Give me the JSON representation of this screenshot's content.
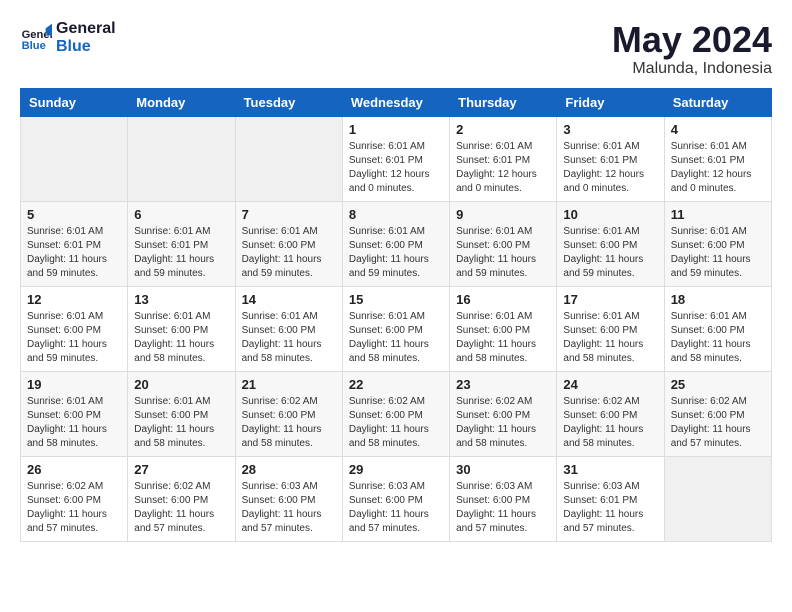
{
  "header": {
    "logo_line1": "General",
    "logo_line2": "Blue",
    "main_title": "May 2024",
    "subtitle": "Malunda, Indonesia"
  },
  "weekdays": [
    "Sunday",
    "Monday",
    "Tuesday",
    "Wednesday",
    "Thursday",
    "Friday",
    "Saturday"
  ],
  "weeks": [
    [
      {
        "day": "",
        "info": ""
      },
      {
        "day": "",
        "info": ""
      },
      {
        "day": "",
        "info": ""
      },
      {
        "day": "1",
        "info": "Sunrise: 6:01 AM\nSunset: 6:01 PM\nDaylight: 12 hours\nand 0 minutes."
      },
      {
        "day": "2",
        "info": "Sunrise: 6:01 AM\nSunset: 6:01 PM\nDaylight: 12 hours\nand 0 minutes."
      },
      {
        "day": "3",
        "info": "Sunrise: 6:01 AM\nSunset: 6:01 PM\nDaylight: 12 hours\nand 0 minutes."
      },
      {
        "day": "4",
        "info": "Sunrise: 6:01 AM\nSunset: 6:01 PM\nDaylight: 12 hours\nand 0 minutes."
      }
    ],
    [
      {
        "day": "5",
        "info": "Sunrise: 6:01 AM\nSunset: 6:01 PM\nDaylight: 11 hours\nand 59 minutes."
      },
      {
        "day": "6",
        "info": "Sunrise: 6:01 AM\nSunset: 6:01 PM\nDaylight: 11 hours\nand 59 minutes."
      },
      {
        "day": "7",
        "info": "Sunrise: 6:01 AM\nSunset: 6:00 PM\nDaylight: 11 hours\nand 59 minutes."
      },
      {
        "day": "8",
        "info": "Sunrise: 6:01 AM\nSunset: 6:00 PM\nDaylight: 11 hours\nand 59 minutes."
      },
      {
        "day": "9",
        "info": "Sunrise: 6:01 AM\nSunset: 6:00 PM\nDaylight: 11 hours\nand 59 minutes."
      },
      {
        "day": "10",
        "info": "Sunrise: 6:01 AM\nSunset: 6:00 PM\nDaylight: 11 hours\nand 59 minutes."
      },
      {
        "day": "11",
        "info": "Sunrise: 6:01 AM\nSunset: 6:00 PM\nDaylight: 11 hours\nand 59 minutes."
      }
    ],
    [
      {
        "day": "12",
        "info": "Sunrise: 6:01 AM\nSunset: 6:00 PM\nDaylight: 11 hours\nand 59 minutes."
      },
      {
        "day": "13",
        "info": "Sunrise: 6:01 AM\nSunset: 6:00 PM\nDaylight: 11 hours\nand 58 minutes."
      },
      {
        "day": "14",
        "info": "Sunrise: 6:01 AM\nSunset: 6:00 PM\nDaylight: 11 hours\nand 58 minutes."
      },
      {
        "day": "15",
        "info": "Sunrise: 6:01 AM\nSunset: 6:00 PM\nDaylight: 11 hours\nand 58 minutes."
      },
      {
        "day": "16",
        "info": "Sunrise: 6:01 AM\nSunset: 6:00 PM\nDaylight: 11 hours\nand 58 minutes."
      },
      {
        "day": "17",
        "info": "Sunrise: 6:01 AM\nSunset: 6:00 PM\nDaylight: 11 hours\nand 58 minutes."
      },
      {
        "day": "18",
        "info": "Sunrise: 6:01 AM\nSunset: 6:00 PM\nDaylight: 11 hours\nand 58 minutes."
      }
    ],
    [
      {
        "day": "19",
        "info": "Sunrise: 6:01 AM\nSunset: 6:00 PM\nDaylight: 11 hours\nand 58 minutes."
      },
      {
        "day": "20",
        "info": "Sunrise: 6:01 AM\nSunset: 6:00 PM\nDaylight: 11 hours\nand 58 minutes."
      },
      {
        "day": "21",
        "info": "Sunrise: 6:02 AM\nSunset: 6:00 PM\nDaylight: 11 hours\nand 58 minutes."
      },
      {
        "day": "22",
        "info": "Sunrise: 6:02 AM\nSunset: 6:00 PM\nDaylight: 11 hours\nand 58 minutes."
      },
      {
        "day": "23",
        "info": "Sunrise: 6:02 AM\nSunset: 6:00 PM\nDaylight: 11 hours\nand 58 minutes."
      },
      {
        "day": "24",
        "info": "Sunrise: 6:02 AM\nSunset: 6:00 PM\nDaylight: 11 hours\nand 58 minutes."
      },
      {
        "day": "25",
        "info": "Sunrise: 6:02 AM\nSunset: 6:00 PM\nDaylight: 11 hours\nand 57 minutes."
      }
    ],
    [
      {
        "day": "26",
        "info": "Sunrise: 6:02 AM\nSunset: 6:00 PM\nDaylight: 11 hours\nand 57 minutes."
      },
      {
        "day": "27",
        "info": "Sunrise: 6:02 AM\nSunset: 6:00 PM\nDaylight: 11 hours\nand 57 minutes."
      },
      {
        "day": "28",
        "info": "Sunrise: 6:03 AM\nSunset: 6:00 PM\nDaylight: 11 hours\nand 57 minutes."
      },
      {
        "day": "29",
        "info": "Sunrise: 6:03 AM\nSunset: 6:00 PM\nDaylight: 11 hours\nand 57 minutes."
      },
      {
        "day": "30",
        "info": "Sunrise: 6:03 AM\nSunset: 6:00 PM\nDaylight: 11 hours\nand 57 minutes."
      },
      {
        "day": "31",
        "info": "Sunrise: 6:03 AM\nSunset: 6:01 PM\nDaylight: 11 hours\nand 57 minutes."
      },
      {
        "day": "",
        "info": ""
      }
    ]
  ]
}
